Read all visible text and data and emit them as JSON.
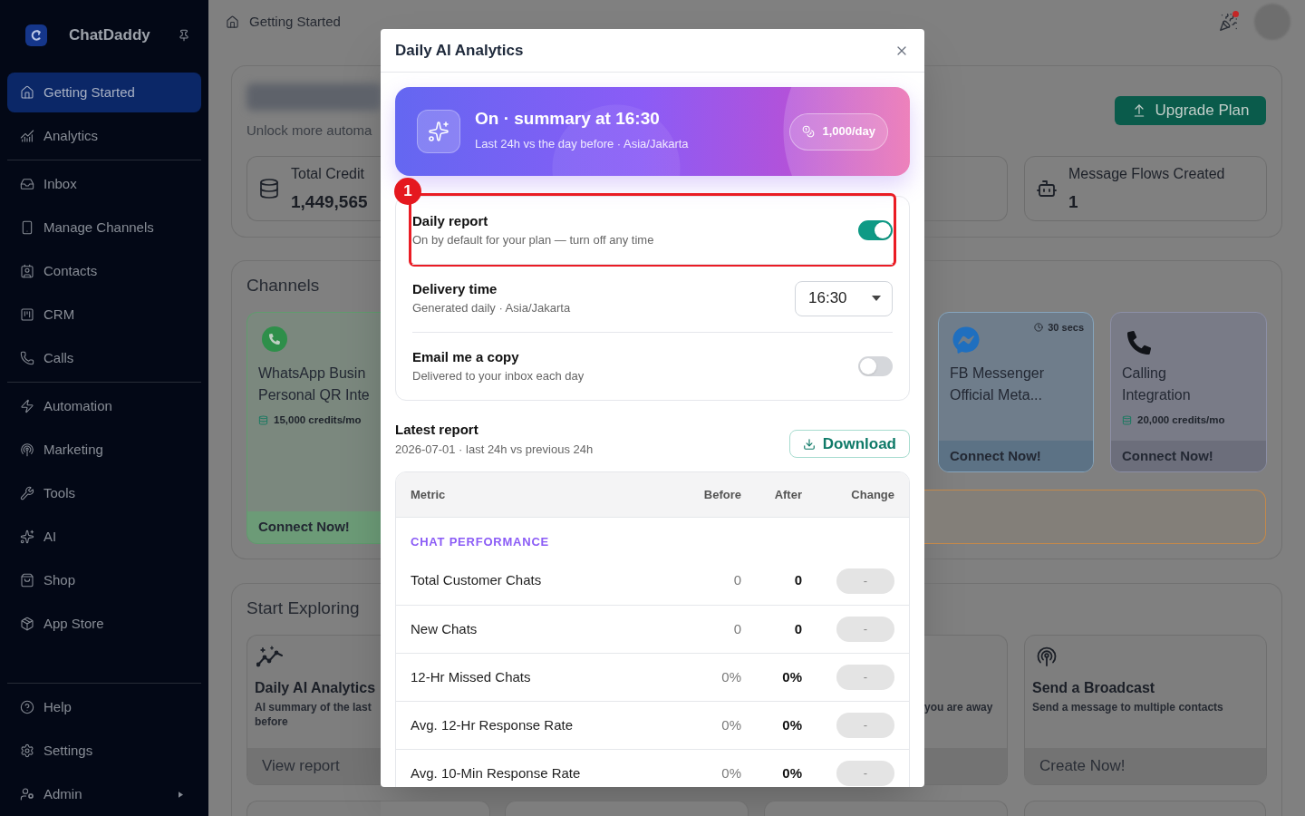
{
  "sidebar": {
    "brand": "ChatDaddy",
    "groups": [
      {
        "items": [
          {
            "label": "Getting Started",
            "selected": true,
            "submenu": false
          },
          {
            "label": "Analytics",
            "selected": false,
            "submenu": false
          }
        ]
      },
      {
        "items": [
          {
            "label": "Inbox",
            "selected": false,
            "submenu": false
          },
          {
            "label": "Manage Channels",
            "selected": false,
            "submenu": false
          },
          {
            "label": "Contacts",
            "selected": false,
            "submenu": false
          },
          {
            "label": "CRM",
            "selected": false,
            "submenu": false
          },
          {
            "label": "Calls",
            "selected": false,
            "submenu": false
          }
        ]
      },
      {
        "items": [
          {
            "label": "Automation",
            "selected": false,
            "submenu": false
          },
          {
            "label": "Marketing",
            "selected": false,
            "submenu": false
          },
          {
            "label": "Tools",
            "selected": false,
            "submenu": false
          },
          {
            "label": "AI",
            "selected": false,
            "submenu": false
          },
          {
            "label": "Shop",
            "selected": false,
            "submenu": false
          },
          {
            "label": "App Store",
            "selected": false,
            "submenu": false
          }
        ]
      },
      {
        "items": [
          {
            "label": "Help",
            "selected": false,
            "submenu": false
          },
          {
            "label": "Settings",
            "selected": false,
            "submenu": false
          },
          {
            "label": "Admin",
            "selected": false,
            "submenu": true
          }
        ]
      }
    ]
  },
  "header": {
    "breadcrumb": "Getting Started",
    "alert": true
  },
  "overview": {
    "subtitle": "Unlock more automa",
    "upgrade_button": "Upgrade Plan",
    "stats": [
      {
        "label": "Total Credit",
        "value": "1,449,565"
      },
      {
        "label": "Message Flows Created",
        "value": "1"
      }
    ]
  },
  "channels": {
    "title": "Channels",
    "cards": [
      {
        "kind": "whatsapp",
        "title_lines": [
          "WhatsApp Busin",
          "Personal QR Inte"
        ],
        "credits": "15,000 credits/mo",
        "action": "Connect Now!"
      },
      {
        "kind": "messenger",
        "time": "30 secs",
        "title_lines": [
          "FB Messenger",
          "Official Meta..."
        ],
        "action": "Connect Now!"
      },
      {
        "kind": "calling",
        "title_lines": [
          "Calling",
          "Integration"
        ],
        "credits": "20,000 credits/mo",
        "action": "Connect Now!"
      }
    ]
  },
  "explore": {
    "title": "Start Exploring",
    "cards": [
      {
        "kind": "analytics",
        "title": "Daily AI Analytics",
        "description_lines": [
          "AI summary of the last",
          "before"
        ],
        "action": "View report"
      },
      {
        "kind": "away",
        "description_lines": [
          "you are away"
        ]
      },
      {
        "kind": "broadcast",
        "title": "Send a Broadcast",
        "description_lines": [
          "Send a message to multiple contacts"
        ],
        "action": "Create Now!"
      }
    ]
  },
  "modal": {
    "title": "Daily AI Analytics",
    "hero": {
      "title": "On · summary at 16:30",
      "subtitle": "Last 24h vs the day before · Asia/Jakarta",
      "quota": "1,000/day"
    },
    "settings": [
      {
        "kind": "toggle",
        "title": "Daily report",
        "description": "On by default for your plan — turn off any time",
        "on": true,
        "annotation": "1"
      },
      {
        "kind": "select",
        "title": "Delivery time",
        "description": "Generated daily · Asia/Jakarta",
        "value": "16:30"
      },
      {
        "kind": "toggle",
        "title": "Email me a copy",
        "description": "Delivered to your inbox each day",
        "on": false
      }
    ],
    "report": {
      "title": "Latest report",
      "subtitle": "2026-07-01 · last 24h vs previous 24h",
      "download_button": "Download",
      "columns": [
        "Metric",
        "Before",
        "After",
        "Change"
      ],
      "sections": [
        {
          "title": "CHAT PERFORMANCE",
          "rows": [
            {
              "metric": "Total Customer Chats",
              "before": "0",
              "after": "0",
              "change": "-"
            },
            {
              "metric": "New Chats",
              "before": "0",
              "after": "0",
              "change": "-"
            },
            {
              "metric": "12-Hr Missed Chats",
              "before": "0%",
              "after": "0%",
              "change": "-"
            },
            {
              "metric": "Avg. 12-Hr Response Rate",
              "before": "0%",
              "after": "0%",
              "change": "-"
            },
            {
              "metric": "Avg. 10-Min Response Rate",
              "before": "0%",
              "after": "0%",
              "change": "-"
            }
          ]
        }
      ]
    }
  }
}
